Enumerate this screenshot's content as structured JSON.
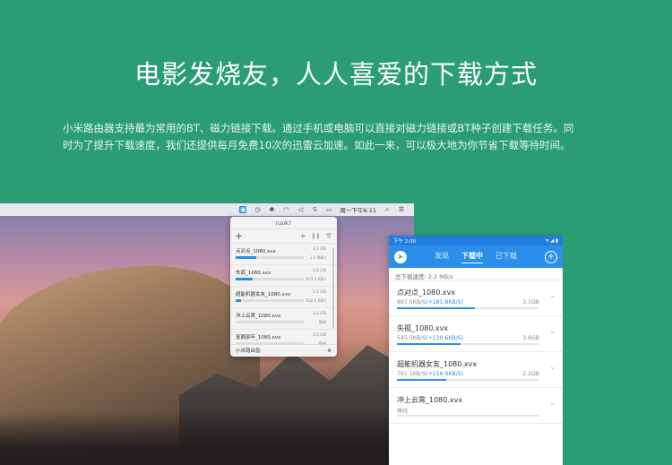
{
  "hero": {
    "title": "电影发烧友，人人喜爱的下载方式",
    "desc_line1": "小米路由器支持最为常用的BT、磁力链接下载。通过手机或电脑可以直接对磁力链接或BT种子创建下载任务。同",
    "desc_line2": "时为了提升下载速度，我们还提供每月免费10次的迅雷云加速。如此一来，可以极大地为你节省下载等待时间。"
  },
  "menubar": {
    "clock": "周一下午6:11"
  },
  "popup": {
    "title": "ruok?",
    "add_label": "+",
    "footer_label": "小米路由盘",
    "items": [
      {
        "name": "点对点_1080.xvx",
        "size": "3.1 GB",
        "speed": "1.1 MB/s",
        "progress": 0.3
      },
      {
        "name": "失孤_1080.xvx",
        "size": "3.6 GB",
        "speed": "872.3 KB/s",
        "progress": 0.25
      },
      {
        "name": "超能机器女友_1080.xvx",
        "size": "2.1 GB",
        "speed": "832.5 KB/s",
        "progress": 0.08
      },
      {
        "name": "冲上云霄_1080.xvx",
        "size": "3.1 GB",
        "speed": "等待",
        "progress": 0.0
      },
      {
        "name": "复联部年_1080.xvx",
        "size": "3.6 GB",
        "speed": "等待",
        "progress": 0.0
      }
    ]
  },
  "phone": {
    "status_time": "下午 2:00",
    "tabs": [
      "发现",
      "下载中",
      "已下载"
    ],
    "active_tab": 1,
    "total_speed": "总下载速度: 2.2 MB/s",
    "items": [
      {
        "name": "点对点_1080.xvx",
        "speed": "897.5KB/S",
        "boost": "(+181.8KB/S)",
        "size": "3.1GB",
        "progress": 0.55
      },
      {
        "name": "失孤_1080.xvx",
        "speed": "545.5KB/S",
        "boost": "(+139.6KB/S)",
        "size": "3.6GB",
        "progress": 0.45
      },
      {
        "name": "超能机器女友_1080.xvx",
        "speed": "791.1KB/S",
        "boost": "(+156.9KB/S)",
        "size": "2.1GB",
        "progress": 0.35
      },
      {
        "name": "冲上云霄_1080.xvx",
        "status": "等待",
        "progress": 0.0
      }
    ]
  },
  "colors": {
    "brand_green": "#2a9d74",
    "accent_blue": "#2b8fea"
  }
}
